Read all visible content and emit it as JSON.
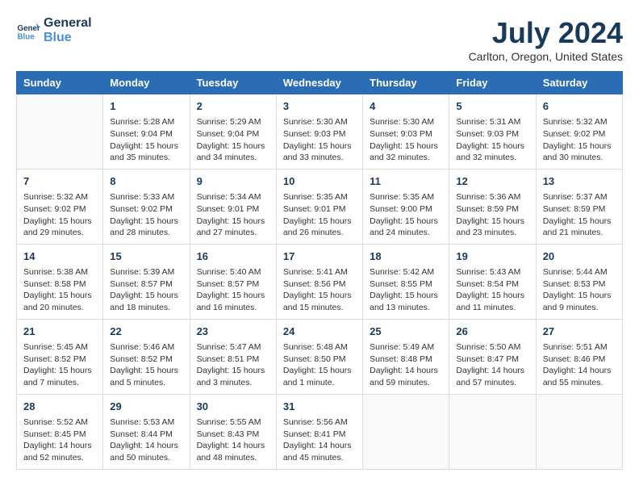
{
  "logo": {
    "line1": "General",
    "line2": "Blue"
  },
  "title": "July 2024",
  "location": "Carlton, Oregon, United States",
  "days_of_week": [
    "Sunday",
    "Monday",
    "Tuesday",
    "Wednesday",
    "Thursday",
    "Friday",
    "Saturday"
  ],
  "weeks": [
    [
      {
        "day": "",
        "detail": ""
      },
      {
        "day": "1",
        "detail": "Sunrise: 5:28 AM\nSunset: 9:04 PM\nDaylight: 15 hours\nand 35 minutes."
      },
      {
        "day": "2",
        "detail": "Sunrise: 5:29 AM\nSunset: 9:04 PM\nDaylight: 15 hours\nand 34 minutes."
      },
      {
        "day": "3",
        "detail": "Sunrise: 5:30 AM\nSunset: 9:03 PM\nDaylight: 15 hours\nand 33 minutes."
      },
      {
        "day": "4",
        "detail": "Sunrise: 5:30 AM\nSunset: 9:03 PM\nDaylight: 15 hours\nand 32 minutes."
      },
      {
        "day": "5",
        "detail": "Sunrise: 5:31 AM\nSunset: 9:03 PM\nDaylight: 15 hours\nand 32 minutes."
      },
      {
        "day": "6",
        "detail": "Sunrise: 5:32 AM\nSunset: 9:02 PM\nDaylight: 15 hours\nand 30 minutes."
      }
    ],
    [
      {
        "day": "7",
        "detail": "Sunrise: 5:32 AM\nSunset: 9:02 PM\nDaylight: 15 hours\nand 29 minutes."
      },
      {
        "day": "8",
        "detail": "Sunrise: 5:33 AM\nSunset: 9:02 PM\nDaylight: 15 hours\nand 28 minutes."
      },
      {
        "day": "9",
        "detail": "Sunrise: 5:34 AM\nSunset: 9:01 PM\nDaylight: 15 hours\nand 27 minutes."
      },
      {
        "day": "10",
        "detail": "Sunrise: 5:35 AM\nSunset: 9:01 PM\nDaylight: 15 hours\nand 26 minutes."
      },
      {
        "day": "11",
        "detail": "Sunrise: 5:35 AM\nSunset: 9:00 PM\nDaylight: 15 hours\nand 24 minutes."
      },
      {
        "day": "12",
        "detail": "Sunrise: 5:36 AM\nSunset: 8:59 PM\nDaylight: 15 hours\nand 23 minutes."
      },
      {
        "day": "13",
        "detail": "Sunrise: 5:37 AM\nSunset: 8:59 PM\nDaylight: 15 hours\nand 21 minutes."
      }
    ],
    [
      {
        "day": "14",
        "detail": "Sunrise: 5:38 AM\nSunset: 8:58 PM\nDaylight: 15 hours\nand 20 minutes."
      },
      {
        "day": "15",
        "detail": "Sunrise: 5:39 AM\nSunset: 8:57 PM\nDaylight: 15 hours\nand 18 minutes."
      },
      {
        "day": "16",
        "detail": "Sunrise: 5:40 AM\nSunset: 8:57 PM\nDaylight: 15 hours\nand 16 minutes."
      },
      {
        "day": "17",
        "detail": "Sunrise: 5:41 AM\nSunset: 8:56 PM\nDaylight: 15 hours\nand 15 minutes."
      },
      {
        "day": "18",
        "detail": "Sunrise: 5:42 AM\nSunset: 8:55 PM\nDaylight: 15 hours\nand 13 minutes."
      },
      {
        "day": "19",
        "detail": "Sunrise: 5:43 AM\nSunset: 8:54 PM\nDaylight: 15 hours\nand 11 minutes."
      },
      {
        "day": "20",
        "detail": "Sunrise: 5:44 AM\nSunset: 8:53 PM\nDaylight: 15 hours\nand 9 minutes."
      }
    ],
    [
      {
        "day": "21",
        "detail": "Sunrise: 5:45 AM\nSunset: 8:52 PM\nDaylight: 15 hours\nand 7 minutes."
      },
      {
        "day": "22",
        "detail": "Sunrise: 5:46 AM\nSunset: 8:52 PM\nDaylight: 15 hours\nand 5 minutes."
      },
      {
        "day": "23",
        "detail": "Sunrise: 5:47 AM\nSunset: 8:51 PM\nDaylight: 15 hours\nand 3 minutes."
      },
      {
        "day": "24",
        "detail": "Sunrise: 5:48 AM\nSunset: 8:50 PM\nDaylight: 15 hours\nand 1 minute."
      },
      {
        "day": "25",
        "detail": "Sunrise: 5:49 AM\nSunset: 8:48 PM\nDaylight: 14 hours\nand 59 minutes."
      },
      {
        "day": "26",
        "detail": "Sunrise: 5:50 AM\nSunset: 8:47 PM\nDaylight: 14 hours\nand 57 minutes."
      },
      {
        "day": "27",
        "detail": "Sunrise: 5:51 AM\nSunset: 8:46 PM\nDaylight: 14 hours\nand 55 minutes."
      }
    ],
    [
      {
        "day": "28",
        "detail": "Sunrise: 5:52 AM\nSunset: 8:45 PM\nDaylight: 14 hours\nand 52 minutes."
      },
      {
        "day": "29",
        "detail": "Sunrise: 5:53 AM\nSunset: 8:44 PM\nDaylight: 14 hours\nand 50 minutes."
      },
      {
        "day": "30",
        "detail": "Sunrise: 5:55 AM\nSunset: 8:43 PM\nDaylight: 14 hours\nand 48 minutes."
      },
      {
        "day": "31",
        "detail": "Sunrise: 5:56 AM\nSunset: 8:41 PM\nDaylight: 14 hours\nand 45 minutes."
      },
      {
        "day": "",
        "detail": ""
      },
      {
        "day": "",
        "detail": ""
      },
      {
        "day": "",
        "detail": ""
      }
    ]
  ]
}
